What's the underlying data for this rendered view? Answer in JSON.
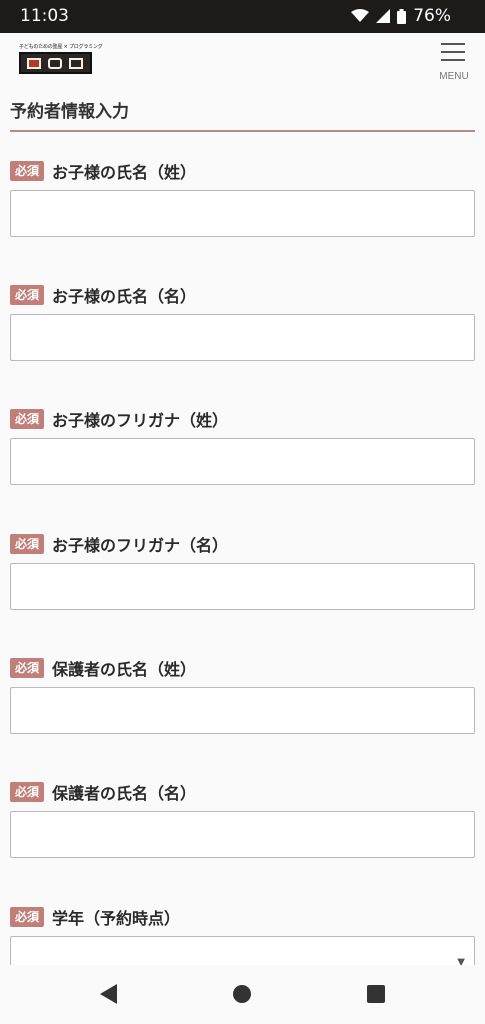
{
  "status": {
    "time": "11:03",
    "battery": "76%"
  },
  "header": {
    "logo_tagline": "子どものための塾屋 × プログラミング",
    "menu_label": "MENU"
  },
  "section_title": "予約者情報入力",
  "required_label": "必須",
  "fields": [
    {
      "label": "お子様の氏名（姓）",
      "value": "",
      "type": "text"
    },
    {
      "label": "お子様の氏名（名）",
      "value": "",
      "type": "text"
    },
    {
      "label": "お子様のフリガナ（姓）",
      "value": "",
      "type": "text"
    },
    {
      "label": "お子様のフリガナ（名）",
      "value": "",
      "type": "text"
    },
    {
      "label": "保護者の氏名（姓）",
      "value": "",
      "type": "text"
    },
    {
      "label": "保護者の氏名（名）",
      "value": "",
      "type": "text"
    },
    {
      "label": "学年（予約時点）",
      "value": "",
      "type": "select"
    }
  ],
  "icons": {
    "wifi": "wifi-icon",
    "signal": "signal-icon",
    "battery": "battery-icon",
    "back": "back-icon",
    "home": "home-icon",
    "recent": "recent-apps-icon"
  }
}
